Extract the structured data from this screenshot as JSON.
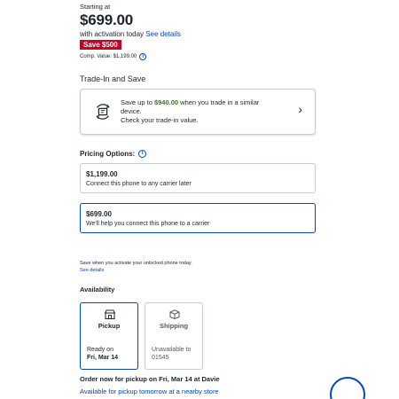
{
  "header": {
    "starting_at": "Starting at",
    "price": "$699.00",
    "activation_text": "with activation today",
    "see_details": "See details",
    "save_badge": "Save $500",
    "comp_value": "Comp. Value: $1,199.00",
    "info_symbol": "i"
  },
  "trade_in": {
    "heading": "Trade-In and Save",
    "line_prefix": "Save up to",
    "amount": "$940.00",
    "line_suffix": "when you trade in a similar device.",
    "line2": "Check your trade-in value.",
    "chevron": "›",
    "icon": "trade-in-phone-icon"
  },
  "pricing": {
    "heading": "Pricing Options:",
    "info_symbol": "i",
    "options": [
      {
        "price": "$1,199.00",
        "desc": "Connect this phone to any carrier later",
        "selected": false
      },
      {
        "price": "$699.00",
        "desc": "We'll help you connect this phone to a carrier",
        "selected": true
      }
    ]
  },
  "save_note": {
    "text": "Save when you activate your unlocked phone today.",
    "link": "See details"
  },
  "availability": {
    "heading": "Availability",
    "pickup": {
      "label": "Pickup",
      "line1": "Ready on",
      "line2": "Fri, Mar 14",
      "icon": "store-icon"
    },
    "shipping": {
      "label": "Shipping",
      "line1": "Unavailable to",
      "line2": "01545",
      "icon": "box-icon"
    },
    "order_now": "Order now for pickup on Fri, Mar 14 at Davie",
    "nearby": "Available for pickup tomorrow at a nearby store"
  },
  "colors": {
    "link_blue": "#0046be",
    "save_red": "#bb0628",
    "green": "#318000",
    "text": "#1d252c"
  }
}
